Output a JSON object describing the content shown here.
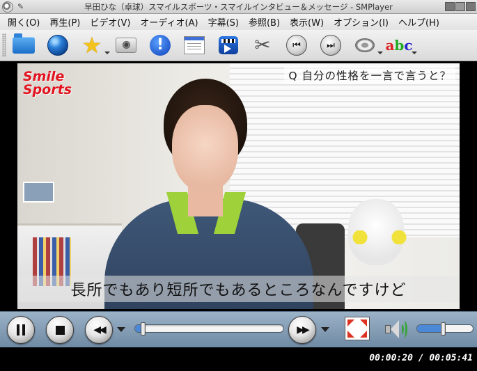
{
  "window": {
    "title": "早田ひな（卓球）スマイルスポーツ・スマイルインタビュー＆メッセージ - SMPlayer"
  },
  "menu": [
    "開く(O)",
    "再生(P)",
    "ビデオ(V)",
    "オーディオ(A)",
    "字幕(S)",
    "参照(B)",
    "表示(W)",
    "オプション(I)",
    "ヘルプ(H)"
  ],
  "toolbar": {
    "icons": [
      "folder-icon",
      "globe-icon",
      "star-icon",
      "screenshot-icon",
      "info-icon",
      "playlist-icon",
      "video-icon",
      "preferences-icon",
      "previous-icon",
      "next-icon",
      "audio-icon",
      "subtitle-icon"
    ],
    "abc": [
      "a",
      "b",
      "c"
    ]
  },
  "video": {
    "logo_line1": "Smile",
    "logo_line2": "Sports",
    "question": "Q 自分の性格を一言で言うと？",
    "subtitle": "長所でもあり短所でもあるところなんですけど"
  },
  "controls": {
    "seek_position_fraction": 0.06,
    "volume_fraction": 0.48
  },
  "status": {
    "time": "00:00:20 / 00:05:41"
  },
  "colors": {
    "accent": "#4c88d8",
    "logo": "#e2141f",
    "collar": "#9fd23a"
  }
}
